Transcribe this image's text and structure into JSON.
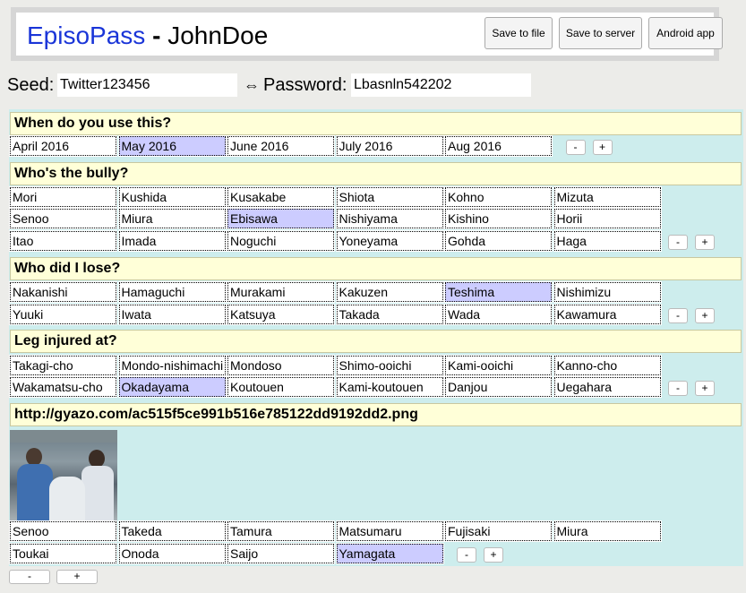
{
  "header": {
    "app_name": "EpisoPass",
    "separator": " - ",
    "user_name": "JohnDoe",
    "buttons": [
      "Save to file",
      "Save to server",
      "Android app"
    ]
  },
  "seed": {
    "label": "Seed:",
    "value": "Twitter123456"
  },
  "arrow": "⇔",
  "password": {
    "label": "Password:",
    "value": "Lbasnln542202"
  },
  "sections": [
    {
      "question": "When do you use this?",
      "rows": [
        [
          "April 2016",
          "May 2016",
          "June 2016",
          "July 2016",
          "Aug 2016"
        ]
      ],
      "selected": "May 2016"
    },
    {
      "question": "Who's the bully?",
      "rows": [
        [
          "Mori",
          "Kushida",
          "Kusakabe",
          "Shiota",
          "Kohno",
          "Mizuta"
        ],
        [
          "Senoo",
          "Miura",
          "Ebisawa",
          "Nishiyama",
          "Kishino",
          "Horii"
        ],
        [
          "Itao",
          "Imada",
          "Noguchi",
          "Yoneyama",
          "Gohda",
          "Haga"
        ]
      ],
      "selected": "Ebisawa"
    },
    {
      "question": "Who did I lose?",
      "rows": [
        [
          "Nakanishi",
          "Hamaguchi",
          "Murakami",
          "Kakuzen",
          "Teshima",
          "Nishimizu"
        ],
        [
          "Yuuki",
          "Iwata",
          "Katsuya",
          "Takada",
          "Wada",
          "Kawamura"
        ]
      ],
      "selected": "Teshima"
    },
    {
      "question": "Leg injured at?",
      "rows": [
        [
          "Takagi-cho",
          "Mondo-nishimachi",
          "Mondoso",
          "Shimo-ooichi",
          "Kami-ooichi",
          "Kanno-cho"
        ],
        [
          "Wakamatsu-cho",
          "Okadayama",
          "Koutouen",
          "Kami-koutouen",
          "Danjou",
          "Uegahara"
        ]
      ],
      "selected": "Okadayama"
    },
    {
      "question": "http://gyazo.com/ac515f5ce991b516e785122dd9192dd2.png",
      "rows": [
        [
          "Senoo",
          "Takeda",
          "Tamura",
          "Matsumaru",
          "Fujisaki",
          "Miura"
        ],
        [
          "Toukai",
          "Onoda",
          "Saijo",
          "Yamagata"
        ]
      ],
      "selected": "Yamagata"
    }
  ],
  "controls": {
    "minus": "-",
    "plus": "+"
  }
}
